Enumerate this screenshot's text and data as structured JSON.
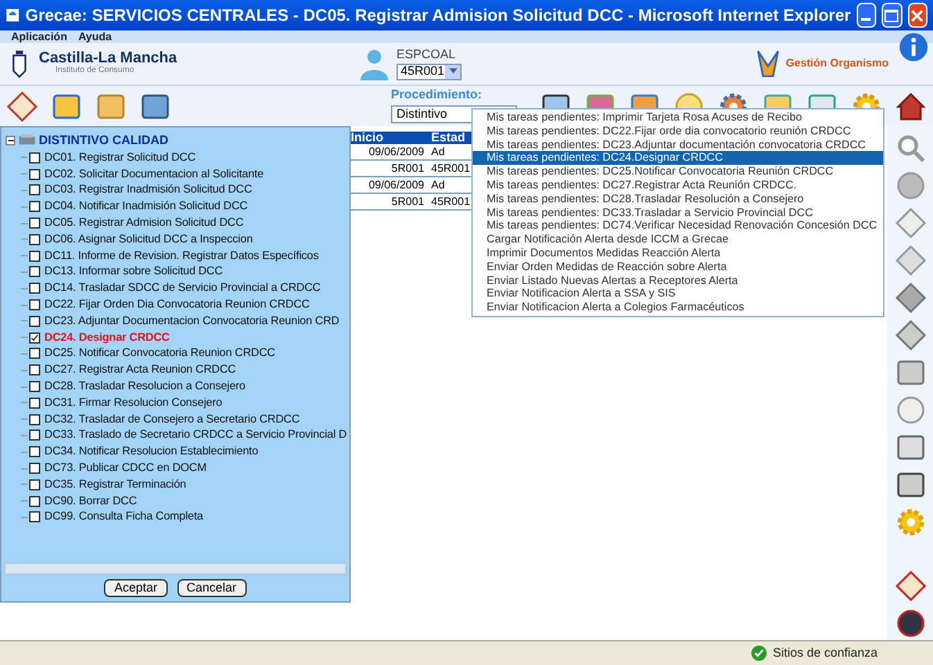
{
  "window": {
    "title": "Grecae: SERVICIOS CENTRALES - DC05. Registrar Admision Solicitud DCC - Microsoft Internet Explorer"
  },
  "menu": [
    "Aplicación",
    "Ayuda"
  ],
  "header": {
    "org_name": "Castilla-La Mancha",
    "org_subtitle": "Instituto de Consumo",
    "user": "ESPCOAL",
    "user_select": "45R001",
    "link": "Gestión Organismo"
  },
  "procedure": {
    "label": "Procedimiento:",
    "value": "Distintivo"
  },
  "tree": {
    "root": "DISTINTIVO CALIDAD",
    "expanded": true,
    "children": [
      {
        "label": "DC01. Registrar Solicitud DCC",
        "checked": false
      },
      {
        "label": "DC02. Solicitar Documentacion al Solicitante",
        "checked": false
      },
      {
        "label": "DC03. Registrar Inadmisión Solicitud DCC",
        "checked": false
      },
      {
        "label": "DC04. Notificar Inadmisión Solicitud DCC",
        "checked": false
      },
      {
        "label": "DC05. Registrar Admision Solicitud DCC",
        "checked": false
      },
      {
        "label": "DC06. Asignar Solicitud DCC a Inspeccion",
        "checked": false
      },
      {
        "label": "DC11. Informe de Revision. Registrar Datos Específicos",
        "checked": false
      },
      {
        "label": "DC13. Informar sobre Solicitud DCC",
        "checked": false
      },
      {
        "label": "DC14. Trasladar SDCC de Servicio Provincial a CRDCC",
        "checked": false
      },
      {
        "label": "DC22. Fijar Orden Dia Convocatoria Reunion CRDCC",
        "checked": false
      },
      {
        "label": "DC23. Adjuntar Documentacion Convocatoria Reunion CRD",
        "checked": false
      },
      {
        "label": "DC24. Designar CRDCC",
        "checked": true
      },
      {
        "label": "DC25. Notificar Convocatoria Reunion CRDCC",
        "checked": false
      },
      {
        "label": "DC27. Registrar Acta Reunion CRDCC",
        "checked": false
      },
      {
        "label": "DC28. Trasladar Resolucion a Consejero",
        "checked": false
      },
      {
        "label": "DC31. Firmar Resolucion Consejero",
        "checked": false
      },
      {
        "label": "DC32. Trasladar de Consejero a Secretario CRDCC",
        "checked": false
      },
      {
        "label": "DC33. Traslado de Secretario CRDCC a Servicio Provincial D",
        "checked": false
      },
      {
        "label": "DC34. Notificar Resolucion Establecimiento",
        "checked": false
      },
      {
        "label": "DC73. Publicar CDCC en DOCM",
        "checked": false
      },
      {
        "label": "DC35. Registrar Terminación",
        "checked": false
      },
      {
        "label": "DC90. Borrar DCC",
        "checked": false
      },
      {
        "label": "DC99. Consulta Ficha Completa",
        "checked": false
      }
    ]
  },
  "tree_buttons": [
    "Aceptar",
    "Cancelar"
  ],
  "table": {
    "columns": [
      "Inicio",
      "Estad"
    ],
    "rows": [
      [
        "09/06/2009",
        "Ad"
      ],
      [
        "5R001",
        "45R001"
      ],
      [
        "09/06/2009",
        "Ad"
      ],
      [
        "5R001",
        "45R001"
      ]
    ]
  },
  "dropdown": [
    {
      "label": "Mis tareas pendientes: Imprimir Tarjeta Rosa Acuses de Recibo",
      "selected": false
    },
    {
      "label": "Mis tareas pendientes: DC22.Fijar orde dia convocatorio reunión CRDCC",
      "selected": false
    },
    {
      "label": "Mis tareas pendientes: DC23.Adjuntar documentación convocatoria CRDCC",
      "selected": false
    },
    {
      "label": "Mis tareas pendientes: DC24.Designar CRDCC",
      "selected": true
    },
    {
      "label": "Mis tareas pendientes: DC25.Notificar Convocatoria Reunión CRDCC",
      "selected": false
    },
    {
      "label": "Mis tareas pendientes: DC27.Registrar Acta Reunión CRDCC.",
      "selected": false
    },
    {
      "label": "Mis tareas pendientes: DC28.Trasladar Resolución a Consejero",
      "selected": false
    },
    {
      "label": "Mis tareas pendientes: DC33.Trasladar a Servicio Provincial DCC",
      "selected": false
    },
    {
      "label": "Mis tareas pendientes: DC74.Verificar Necesidad Renovación Concesión DCC",
      "selected": false
    },
    {
      "label": "Cargar Notificación Alerta desde ICCM a Grecae",
      "selected": false
    },
    {
      "label": "Imprimir Documentos Medidas Reacción Alerta",
      "selected": false
    },
    {
      "label": "Enviar Orden Medidas de Reacción sobre Alerta",
      "selected": false
    },
    {
      "label": "Enviar Listado Nuevas Alertas a Receptores Alerta",
      "selected": false
    },
    {
      "label": "Enviar Notificacion Alerta a SSA y SIS",
      "selected": false
    },
    {
      "label": "Enviar Notificacion Alerta a Colegios Farmacéuticos",
      "selected": false
    }
  ],
  "status_bar": {
    "zone": "Sitios de confianza"
  }
}
